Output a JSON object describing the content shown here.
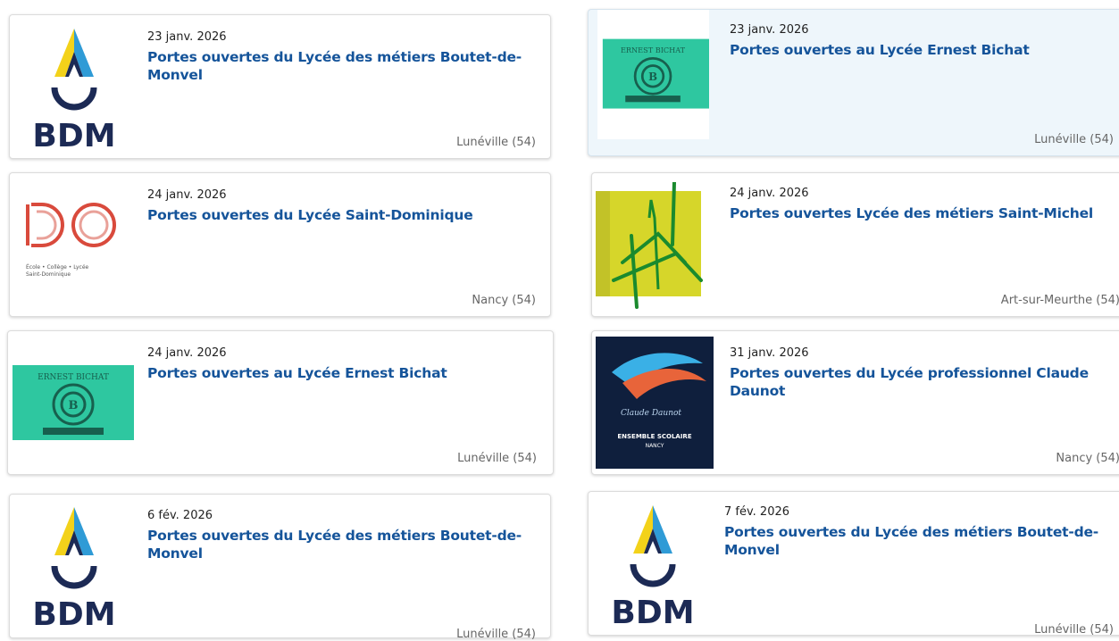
{
  "events": [
    {
      "date": "23 janv. 2026",
      "title": "Portes ouvertes du Lycée des métiers Boutet-de-Monvel",
      "location": "Lunéville (54)",
      "logo": "bdm-logo"
    },
    {
      "date": "23 janv. 2026",
      "title": "Portes ouvertes au Lycée Ernest Bichat",
      "location": "Lunéville (54)",
      "logo": "ernest-bichat-logo"
    },
    {
      "date": "24 janv. 2026",
      "title": "Portes ouvertes du Lycée Saint-Dominique",
      "location": "Nancy (54)",
      "logo": "saint-dominique-logo",
      "logo_text": "École • Collège • Lycée Saint-Dominique"
    },
    {
      "date": "24 janv. 2026",
      "title": "Portes ouvertes Lycée des métiers Saint-Michel",
      "location": "Art-sur-Meurthe (54)",
      "logo": "saint-michel-logo"
    },
    {
      "date": "24 janv. 2026",
      "title": "Portes ouvertes au Lycée Ernest Bichat",
      "location": "Lunéville (54)",
      "logo": "ernest-bichat-logo"
    },
    {
      "date": "31 janv. 2026",
      "title": "Portes ouvertes du Lycée professionnel Claude Daunot",
      "location": "Nancy (54)",
      "logo": "claude-daunot-logo",
      "logo_text": "ENSEMBLE SCOLAIRE NANCY"
    },
    {
      "date": "6 fév. 2026",
      "title": "Portes ouvertes du Lycée des métiers Boutet-de-Monvel",
      "location": "Lunéville (54)",
      "logo": "bdm-logo"
    },
    {
      "date": "7 fév. 2026",
      "title": "Portes ouvertes du Lycée des métiers Boutet-de-Monvel",
      "location": "Lunéville (54)",
      "logo": "bdm-logo"
    }
  ],
  "colors": {
    "title": "#15549a",
    "bdm_yellow": "#f3d21a",
    "bdm_blue": "#2f9bd6",
    "bdm_navy": "#1c2a55",
    "bichat_teal": "#2ec7a0",
    "dominique_red": "#d94a3c",
    "michel_yellow": "#d6d62a",
    "michel_green": "#1a8a2e",
    "daunot_navy": "#0f1f3d"
  }
}
